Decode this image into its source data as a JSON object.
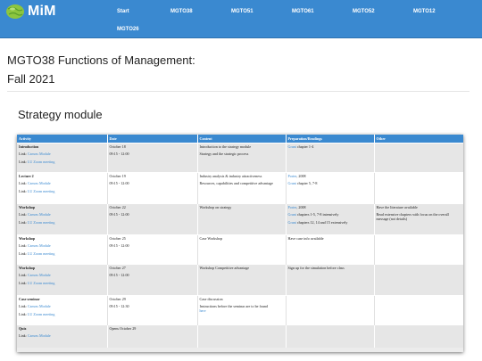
{
  "brand": {
    "name": "MiM",
    "icon": "globe-icon"
  },
  "nav": [
    "Start",
    "MGTO38",
    "MGTO51",
    "MGTO61",
    "MGTO52",
    "MGTO12",
    "MGTO26"
  ],
  "title_line1": "MGTO38 Functions of Management:",
  "title_line2": "Fall 2021",
  "section_title": "Strategy module",
  "table": {
    "headers": [
      "Activity",
      "Date",
      "Content",
      "Preparation/Readings",
      "Other"
    ],
    "rows": [
      {
        "activity": "Introduction",
        "link1_label": "Link:",
        "link1_text": "Canvas Module",
        "link2_label": "Link:",
        "link2_text": "LU Zoom meeting",
        "date": "October 18",
        "time": "09:15 - 12:00",
        "content": [
          "Introduction to the strategy module",
          "Strategy and the strategic process"
        ],
        "prep": [
          {
            "link": "Grant",
            "text": " chapter 1-4"
          }
        ],
        "other": []
      },
      {
        "activity": "Lecture 2",
        "link1_label": "Link:",
        "link1_text": "Canvas Module",
        "link2_label": "Link:",
        "link2_text": "LU Zoom meeting",
        "date": "October 19",
        "time": "09:15 - 12:00",
        "content": [
          "Industry analysis & industry attractiveness",
          "Resources, capabilities and competitive advantage"
        ],
        "prep": [
          {
            "link": "Porter",
            "text": ", 2008"
          },
          {
            "link": "Grant",
            "text": " chapter 5, 7-8"
          }
        ],
        "other": []
      },
      {
        "activity": "Workshop",
        "link1_label": "Link:",
        "link1_text": "Canvas Module",
        "link2_label": "Link:",
        "link2_text": "LU Zoom meeting",
        "date": "October 22",
        "time": "09:15 - 12:00",
        "content": [
          "Workshop on strategy"
        ],
        "prep": [
          {
            "link": "Porter",
            "text": ", 2008"
          },
          {
            "link": "Grant",
            "text": " chapters 1-5, 7-8 intensively"
          },
          {
            "link": "Grant",
            "text": " chapters 12, 14 and 15 extensively"
          }
        ],
        "other": [
          "Have the literature available",
          "Read extensive chapters with focus on the overall message (not details)"
        ]
      },
      {
        "activity": "Workshop",
        "link1_label": "Link:",
        "link1_text": "Canvas Module",
        "link2_label": "Link:",
        "link2_text": "LU Zoom meeting",
        "date": "October 25",
        "time": "09:15 - 12:00",
        "content": [
          "Case Workshop"
        ],
        "prep": [
          {
            "link": "",
            "text": "Have case info available"
          }
        ],
        "other": []
      },
      {
        "activity": "Workshop",
        "link1_label": "Link:",
        "link1_text": "Canvas Module",
        "link2_label": "Link:",
        "link2_text": "LU Zoom meeting",
        "date": "October 27",
        "time": "09:15 - 12:00",
        "content": [
          "Workshop Competitive advantage"
        ],
        "prep": [
          {
            "link": "",
            "text": "Sign up for the simulation before class"
          }
        ],
        "other": []
      },
      {
        "activity": "Case seminar",
        "link1_label": "Link:",
        "link1_text": "Canvas Module",
        "link2_label": "Link:",
        "link2_text": "LU Zoom meeting",
        "date": "October 29",
        "time": "09:15 - 12:30",
        "content": [
          "Case discussion",
          "Instructions before the seminar are to be found"
        ],
        "content_link": "here",
        "prep": [],
        "other": []
      },
      {
        "activity": "Quiz",
        "link1_label": "Link:",
        "link1_text": "Canvas Module",
        "link2_label": "",
        "link2_text": "",
        "date": "Opens October 29",
        "time": "",
        "content": [],
        "prep": [],
        "other": []
      }
    ]
  }
}
